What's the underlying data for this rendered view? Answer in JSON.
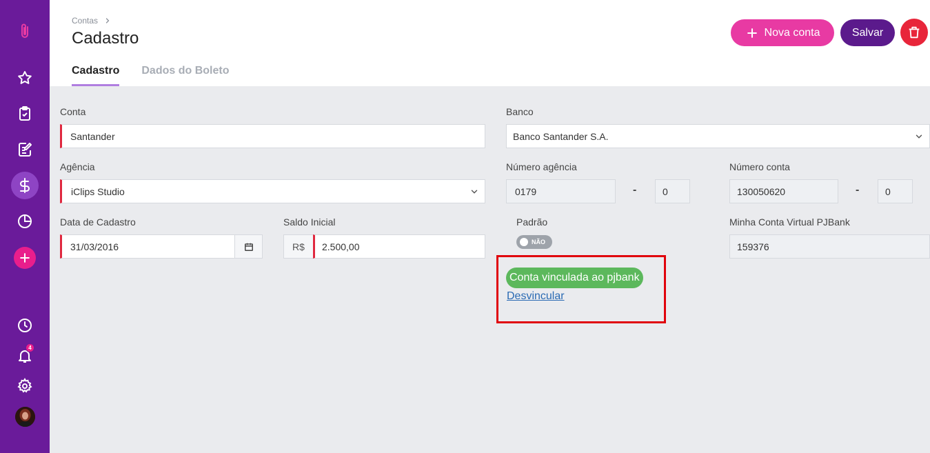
{
  "sidebar": {
    "icons": [
      "paperclip-logo-icon",
      "star-icon",
      "clipboard-check-icon",
      "edit-document-icon",
      "dollar-icon",
      "pie-chart-icon",
      "plus-icon",
      "clock-icon",
      "bell-icon",
      "gear-icon",
      "avatar"
    ],
    "notification_count": "4"
  },
  "header": {
    "breadcrumb": "Contas",
    "title": "Cadastro",
    "tabs": [
      {
        "label": "Cadastro",
        "active": true
      },
      {
        "label": "Dados do Boleto",
        "active": false
      }
    ],
    "new_account_label": "Nova conta",
    "save_label": "Salvar"
  },
  "form": {
    "conta": {
      "label": "Conta",
      "value": "Santander"
    },
    "banco": {
      "label": "Banco",
      "value": "Banco Santander S.A."
    },
    "agencia": {
      "label": "Agência",
      "value": "iClips Studio"
    },
    "numero_agencia": {
      "label": "Número agência",
      "value": "0179",
      "digit": "0"
    },
    "numero_conta": {
      "label": "Número conta",
      "value": "130050620",
      "digit": "0"
    },
    "data_cadastro": {
      "label": "Data de Cadastro",
      "value": "31/03/2016"
    },
    "saldo_inicial": {
      "label": "Saldo Inicial",
      "currency": "R$",
      "value": "2.500,00"
    },
    "padrao": {
      "label": "Padrão",
      "toggle_text": "NÃO"
    },
    "conta_virtual": {
      "label": "Minha Conta Virtual PJBank",
      "value": "159376"
    },
    "dash": "-"
  },
  "pjbank": {
    "badge": "Conta vinculada ao pjbank",
    "unlink_label": "Desvincular"
  },
  "colors": {
    "sidebar": "#6a1b9a",
    "accent_pink": "#e83aa3",
    "save_purple": "#5b1a8c",
    "delete_red": "#e8253a",
    "success_green": "#5cb85c",
    "required_red": "#e0283f"
  }
}
